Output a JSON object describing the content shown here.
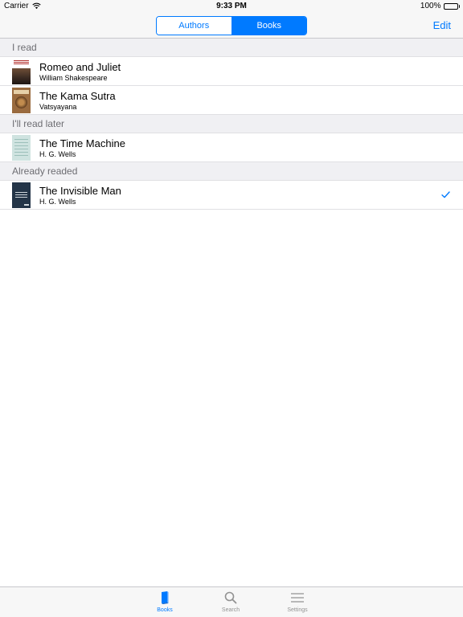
{
  "status_bar": {
    "carrier": "Carrier",
    "time": "9:33 PM",
    "battery": "100%"
  },
  "nav": {
    "segments": [
      {
        "label": "Authors",
        "selected": false
      },
      {
        "label": "Books",
        "selected": true
      }
    ],
    "edit_label": "Edit"
  },
  "sections": [
    {
      "header": "I read",
      "rows": [
        {
          "title": "Romeo and Juliet",
          "author": "William Shakespeare",
          "checked": false
        },
        {
          "title": "The Kama Sutra",
          "author": "Vatsyayana",
          "checked": false
        }
      ]
    },
    {
      "header": "I'll read later",
      "rows": [
        {
          "title": "The Time Machine",
          "author": "H. G. Wells",
          "checked": false
        }
      ]
    },
    {
      "header": "Already readed",
      "rows": [
        {
          "title": "The Invisible Man",
          "author": "H. G. Wells",
          "checked": true
        }
      ]
    }
  ],
  "tab_bar": {
    "items": [
      {
        "label": "Books",
        "icon": "book-icon",
        "active": true
      },
      {
        "label": "Search",
        "icon": "search-icon",
        "active": false
      },
      {
        "label": "Settings",
        "icon": "menu-lines-icon",
        "active": false
      }
    ]
  },
  "colors": {
    "accent": "#007aff",
    "bar_background": "#f7f7f7",
    "section_background": "#f0f0f3",
    "inactive_tab": "#929292"
  }
}
